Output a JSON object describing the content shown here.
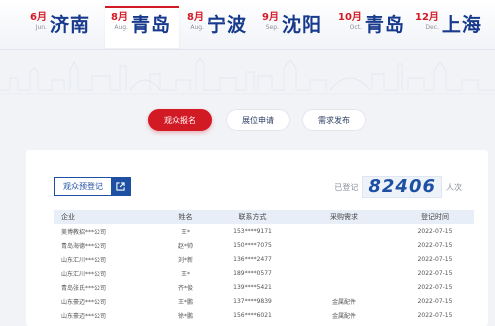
{
  "cities": [
    {
      "month": "6月",
      "month_en": "Jun.",
      "name": "济南"
    },
    {
      "month": "8月",
      "month_en": "Aug.",
      "name": "青岛",
      "active": true
    },
    {
      "month": "8月",
      "month_en": "Aug.",
      "name": "宁波"
    },
    {
      "month": "9月",
      "month_en": "Sep.",
      "name": "沈阳"
    },
    {
      "month": "10月",
      "month_en": "Oct.",
      "name": "青岛"
    },
    {
      "month": "12月",
      "month_en": "Dec.",
      "name": "上海"
    }
  ],
  "actions": {
    "visitor": "观众报名",
    "booth": "展位申请",
    "demand": "需求发布"
  },
  "register": {
    "label": "观众预登记"
  },
  "counter": {
    "prefix": "已登记",
    "value": "82406",
    "suffix": "人次"
  },
  "table": {
    "headers": {
      "company": "企业",
      "name": "姓名",
      "phone": "联系方式",
      "demand": "采购需求",
      "time": "登记时间"
    },
    "rows": [
      {
        "company": "美博教招***公司",
        "name": "王*",
        "phone": "153****9171",
        "demand": "",
        "time": "2022-07-15"
      },
      {
        "company": "青岛海德***公司",
        "name": "赵*帅",
        "phone": "150****7075",
        "demand": "",
        "time": "2022-07-15"
      },
      {
        "company": "山东汇川***公司",
        "name": "刘*新",
        "phone": "136****2477",
        "demand": "",
        "time": "2022-07-15"
      },
      {
        "company": "山东汇川***公司",
        "name": "王*",
        "phone": "189****0577",
        "demand": "",
        "time": "2022-07-15"
      },
      {
        "company": "青岛张氏***公司",
        "name": "齐*俊",
        "phone": "139****5421",
        "demand": "",
        "time": "2022-07-15"
      },
      {
        "company": "山东豪迈***公司",
        "name": "王*鹏",
        "phone": "137****9839",
        "demand": "金属配件",
        "time": "2022-07-15"
      },
      {
        "company": "山东豪迈***公司",
        "name": "徐*鹏",
        "phone": "156****6021",
        "demand": "金属配件",
        "time": "2022-07-15"
      }
    ]
  },
  "colors": {
    "accent": "#d21a25",
    "brand": "#1d4fa3",
    "city": "#183a8c"
  }
}
